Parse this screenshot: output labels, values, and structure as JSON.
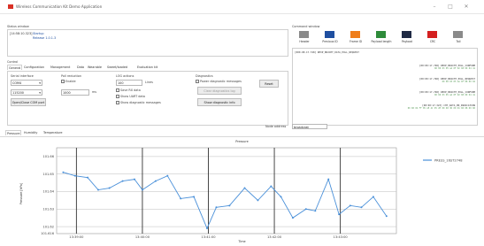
{
  "window": {
    "title": "Wireless Communication Kit Demo Application",
    "min_icon": "minimize-icon",
    "max_icon": "maximize-icon",
    "close_icon": "close-icon"
  },
  "status_window": {
    "label": "Status window",
    "timestamp": "[14:58:10.323]",
    "line1": "Startup",
    "line2": "Release 1.0.1.3"
  },
  "command_window": {
    "label": "Command window",
    "legend": [
      {
        "name": "Header",
        "color": "#8a8a8a"
      },
      {
        "name": "Previous ID",
        "color": "#1f4fa0"
      },
      {
        "name": "Frame ID",
        "color": "#ef7d1a"
      },
      {
        "name": "Payload length",
        "color": "#2e8b3a"
      },
      {
        "name": "Payload",
        "color": "#1f2a44"
      },
      {
        "name": "CRC",
        "color": "#d42020"
      },
      {
        "name": "Tail",
        "color": "#8a8a8a"
      }
    ],
    "lines": [
      {
        "main": "[000.08.17.748] REXP_BK2CHT_DATA_POLL_REQUEST",
        "sub": "",
        "align": "left"
      },
      {
        "main": "[00:00:17.748] REXP_BK2CHT_POLL_CONFIRM",
        "sub": "00 00 03 05 AA 0F 02 08 00 04 41",
        "align": "right"
      },
      {
        "main": "[00:00:17.748] REXP_BK2CHT_POLL_REQUEST",
        "sub": "00 00 03 05 AA 0F 08 00 04",
        "align": "right"
      },
      {
        "main": "[00:00:17.748] REXP_BK2CHT_POLL_CONFIRM",
        "sub": "00 00 03 05 AA 0F 02 08 00 04 41",
        "align": "right"
      },
      {
        "main": "[00:00:17.323] CHT_DATA_PN_INDICATION",
        "sub": "00 00 02 FF 05 AE 4C 05 2E 00 00 3D 00 01 00 08 00 00",
        "align": "right"
      }
    ]
  },
  "control": {
    "label": "Control",
    "tabs": [
      "General",
      "Configuration",
      "Management",
      "Data",
      "Wearable",
      "Sweet/loaded",
      "Evaluation kit"
    ],
    "active_tab": "General",
    "serial_label": "Serial interface",
    "serial_value": "COM4",
    "baud_value": "115200",
    "open_button": "Open/Close COM port",
    "poll_label": "Poll reduction",
    "poll_enable": "Enable",
    "poll_value": "1000",
    "poll_unit": "ms",
    "lod_label": "LOG actions",
    "lod_value": "100",
    "lod_unit": "Lines",
    "save_rx": "Save RX data",
    "show_uart": "Show UART data",
    "show_diag": "Show diagnostic messages",
    "diagnostics_label": "Diagnostics",
    "power_diag": "Power diagnostic messages",
    "clear_button": "Clear diagnostics log",
    "show_diag_button": "Show diagnostic info",
    "reset_button": "Reset",
    "node_label": "Node address",
    "node_value": "broadcast"
  },
  "plot_tabs": [
    "Pressure",
    "Humidity",
    "Temperature"
  ],
  "active_plot_tab": "Pressure",
  "chart_data": {
    "type": "line",
    "title": "Pressure",
    "xlabel": "Time",
    "ylabel": "Pressure [hPa]",
    "ylim": [
      101.616,
      101.665
    ],
    "yticks": [
      "101.66",
      "101.65",
      "101.64",
      "101.63",
      "101.62",
      "101.616"
    ],
    "ytick_values": [
      101.66,
      101.65,
      101.64,
      101.63,
      101.62,
      101.616
    ],
    "xticks": [
      "13:39:00",
      "13:40:00",
      "13:41:00",
      "13:42:00",
      "13:43:00"
    ],
    "x_first_minute": 39,
    "x": [
      38.8,
      38.98,
      39.17,
      39.33,
      39.5,
      39.7,
      39.88,
      40.0,
      40.2,
      40.38,
      40.58,
      40.78,
      40.98,
      41.12,
      41.32,
      41.55,
      41.75,
      41.95,
      42.1,
      42.28,
      42.48,
      42.62,
      42.82,
      42.98,
      43.15,
      43.32,
      43.5,
      43.7
    ],
    "series": [
      {
        "name": "PRESS_16ST2748",
        "color": "#4a90d9",
        "values": [
          101.651,
          101.649,
          101.648,
          101.641,
          101.642,
          101.646,
          101.647,
          101.641,
          101.646,
          101.649,
          101.636,
          101.637,
          101.619,
          101.631,
          101.632,
          101.642,
          101.635,
          101.643,
          101.637,
          101.625,
          101.63,
          101.629,
          101.647,
          101.627,
          101.632,
          101.631,
          101.637,
          101.626
        ]
      }
    ]
  }
}
